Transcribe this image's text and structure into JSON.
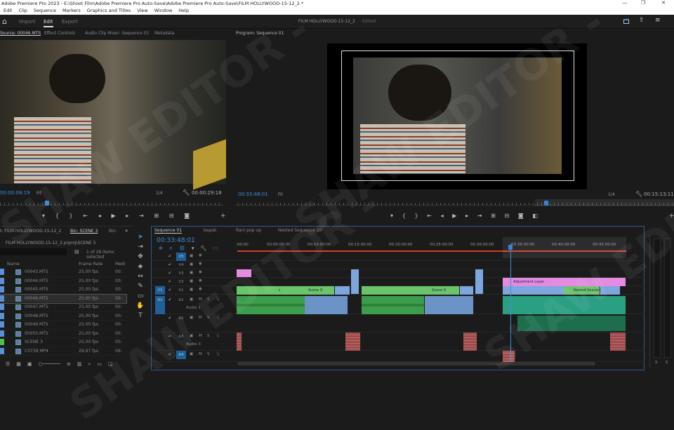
{
  "window": {
    "title": "Adobe Premiere Pro 2023 - E:\\Shoot Film\\Adobe Premiere Pro Auto-Save\\Adobe Premiere Pro Auto-Save\\FILM HOLLYWOOD-15-12_2 *",
    "minimize": "—",
    "maximize": "❐",
    "close": "✕"
  },
  "menu": [
    "Edit",
    "Clip",
    "Sequence",
    "Markers",
    "Graphics and Titles",
    "View",
    "Window",
    "Help"
  ],
  "workspaces": {
    "import": "Import",
    "edit": "Edit",
    "export": "Export",
    "project_name": "FILM HOLLYWOOD-15-12_2",
    "status": "- Edited"
  },
  "source_tabs": [
    "Source: 00046.MTS",
    "Effect Controls",
    "Audio Clip Mixer: Sequence 01",
    "Metadata"
  ],
  "program_tab": "Program: Sequence 01",
  "source": {
    "timecode": "00:00:08:19",
    "fit": "Fit",
    "resolution": "1/4",
    "duration": "00:00:29:18",
    "progress": 0.18
  },
  "program": {
    "timecode": "00:33:48:01",
    "fit": "Fit",
    "resolution": "1/4",
    "duration": "00:15:13:11",
    "progress": 0.7
  },
  "project": {
    "tab_project": "t: FILM HOLLYWOOD-15-12_2",
    "tab_bin": "Bin: SCENE 3",
    "tab_bin2": "Bin:",
    "path": "FILM HOLLYWOOD-15-12_2.prproj\\SCENE 3",
    "selected": "1 of 18 items selected",
    "columns": {
      "name": "Name",
      "frame_rate": "Frame Rate",
      "media": "Medi"
    },
    "items": [
      {
        "name": "00043.MTS",
        "fps": "25,00 fps",
        "media": "00:"
      },
      {
        "name": "00044.MTS",
        "fps": "25,00 fps",
        "media": "00:"
      },
      {
        "name": "00045.MTS",
        "fps": "25,00 fps",
        "media": "00:"
      },
      {
        "name": "00046.MTS",
        "fps": "25,00 fps",
        "media": "00:"
      },
      {
        "name": "00047.MTS",
        "fps": "25,00 fps",
        "media": "00:"
      },
      {
        "name": "00048.MTS",
        "fps": "25,00 fps",
        "media": "00:"
      },
      {
        "name": "00049.MTS",
        "fps": "25,00 fps",
        "media": "00:"
      },
      {
        "name": "00050.MTS",
        "fps": "25,00 fps",
        "media": "00:"
      },
      {
        "name": "SCENE 3",
        "fps": "25,00 fps",
        "media": "00:"
      },
      {
        "name": "C0739.MP4",
        "fps": "29,97 fps",
        "media": "06:"
      }
    ]
  },
  "timeline": {
    "tabs": [
      "Sequence 01",
      "bapak",
      "Rani pop up",
      "Nested Sequence 20"
    ],
    "timecode": "00:33:48:01",
    "ruler": [
      ":00:00",
      "00:05:00:00",
      "00:10:00:00",
      "00:15:00:00",
      "00:20:00:00",
      "00:25:00:00",
      "00:30:00:00",
      "00:35:00:00",
      "00:40:00:00",
      "00:45:00:00"
    ],
    "video_tracks": [
      "V5",
      "V4",
      "V3",
      "V2",
      "V1"
    ],
    "audio_tracks": [
      "A1",
      "A2",
      "A3",
      "A4"
    ],
    "audio_names": {
      "a1": "Audio 1",
      "a3": "Audio 3"
    },
    "mute": "M",
    "solo": "S",
    "clips": {
      "scene": "scene",
      "scene9": "Scene 9",
      "adjustment": "Adjustment Layer",
      "nested": "Nested Sequenc"
    }
  },
  "meters": {
    "s1": "S",
    "s2": "S"
  },
  "watermark": "SHAW EDITOR -"
}
